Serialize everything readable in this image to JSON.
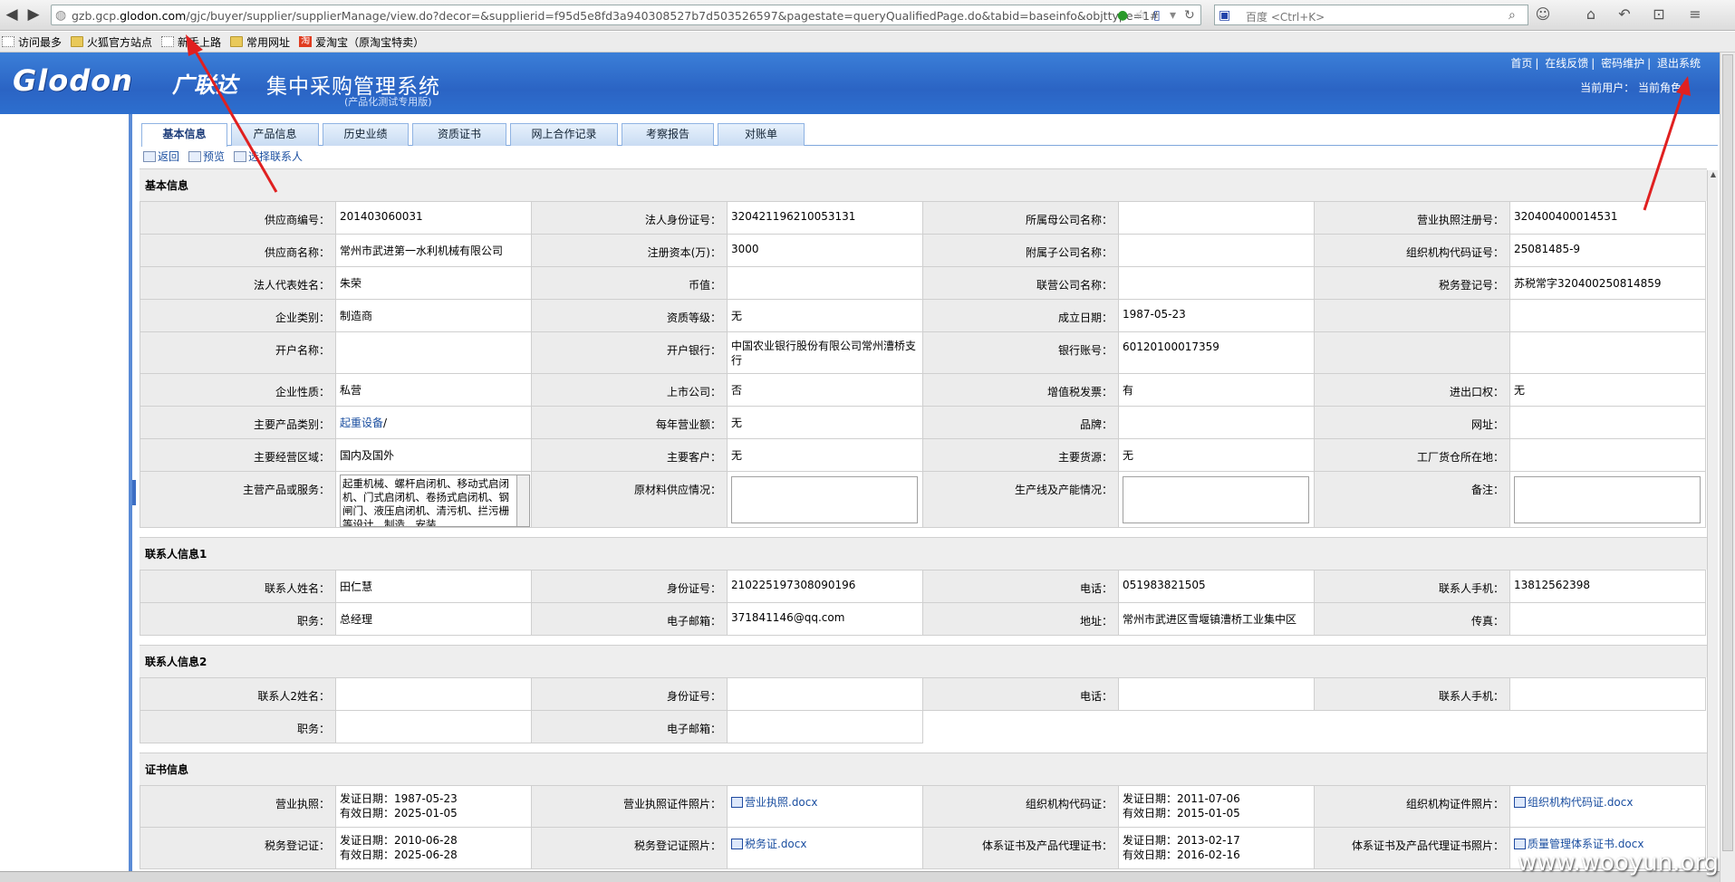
{
  "browser": {
    "url_prefix": "gzb.gcp.",
    "url_domain": "glodon.com",
    "url_path": "/gjc/buyer/supplier/supplierManage/view.do?decor=&supplierid=f95d5e8fd3a940308527b7d503526597&pagestate=queryQualifiedPage.do&tabid=baseinfo&objttype=1#",
    "search_placeholder": "百度 <Ctrl+K>"
  },
  "bookmarks": [
    "访问最多",
    "火狐官方站点",
    "新手上路",
    "常用网址",
    "爱淘宝（原淘宝特卖）"
  ],
  "header": {
    "logo": "Glodon",
    "logo_cn": "广联达",
    "title": "集中采购管理系统",
    "subtitle": "(产品化测试专用版)",
    "links": [
      "首页",
      "在线反馈",
      "密码维护",
      "退出系统"
    ],
    "user_info": "当前用户： 当前角色："
  },
  "tabs": [
    "基本信息",
    "产品信息",
    "历史业绩",
    "资质证书",
    "网上合作记录",
    "考察报告",
    "对账单"
  ],
  "actions": [
    "返回",
    "预览",
    "选择联系人"
  ],
  "sections": {
    "basic": "基本信息",
    "contact1": "联系人信息1",
    "contact2": "联系人信息2",
    "cert": "证书信息"
  },
  "basic": {
    "r1": [
      "供应商编号：",
      "201403060031",
      "法人身份证号：",
      "320421196210053131",
      "所属母公司名称：",
      "",
      "营业执照注册号：",
      "320400400014531"
    ],
    "r2": [
      "供应商名称：",
      "常州市武进第一水利机械有限公司",
      "注册资本(万)：",
      "3000",
      "附属子公司名称：",
      "",
      "组织机构代码证号：",
      "25081485-9"
    ],
    "r3": [
      "法人代表姓名：",
      "朱荣",
      "币值：",
      "",
      "联营公司名称：",
      "",
      "税务登记号：",
      "苏税常字320400250814859"
    ],
    "r4": [
      "企业类别：",
      "制造商",
      "资质等级：",
      "无",
      "成立日期：",
      "1987-05-23",
      "",
      ""
    ],
    "r5": [
      "开户名称：",
      "",
      "开户银行：",
      "中国农业银行股份有限公司常州漕桥支行",
      "银行账号：",
      "60120100017359",
      "",
      ""
    ],
    "r6": [
      "企业性质：",
      "私营",
      "上市公司：",
      "否",
      "增值税发票：",
      "有",
      "进出口权：",
      "无"
    ],
    "r7": [
      "主要产品类别：",
      "起重设备",
      "每年营业额：",
      "无",
      "品牌：",
      "",
      "网址：",
      ""
    ],
    "r8": [
      "主要经营区域：",
      "国内及国外",
      "主要客户：",
      "无",
      "主要货源：",
      "无",
      "工厂货仓所在地：",
      ""
    ],
    "r9_labels": [
      "主营产品或服务：",
      "原材料供应情况：",
      "生产线及产能情况：",
      "备注："
    ],
    "r9_service": "起重机械、螺杆启闭机、移动式启闭机、门式启闭机、卷扬式启闭机、钢闸门、液压启闭机、清污机、拦污栅等设计、制造、安装"
  },
  "contact1": {
    "r1": [
      "联系人姓名：",
      "田仁慧",
      "身份证号：",
      "210225197308090196",
      "电话：",
      "051983821505",
      "联系人手机：",
      "13812562398"
    ],
    "r2": [
      "职务：",
      "总经理",
      "电子邮箱：",
      "371841146@qq.com",
      "地址：",
      "常州市武进区雪堰镇漕桥工业集中区",
      "传真：",
      ""
    ]
  },
  "contact2": {
    "r1": [
      "联系人2姓名：",
      "",
      "身份证号：",
      "",
      "电话：",
      "",
      "联系人手机：",
      ""
    ],
    "r2": [
      "职务：",
      "",
      "电子邮箱：",
      ""
    ]
  },
  "cert": {
    "r1": [
      "营业执照：",
      "发证日期：1987-05-23",
      "有效日期：2025-01-05",
      "营业执照证件照片：",
      "营业执照.docx",
      "组织机构代码证：",
      "发证日期：2011-07-06",
      "有效日期：2015-01-05",
      "组织机构证件照片：",
      "组织机构代码证.docx"
    ],
    "r2": [
      "税务登记证：",
      "发证日期：2010-06-28",
      "有效日期：2025-06-28",
      "税务登记证照片：",
      "税务证.docx",
      "体系证书及产品代理证书：",
      "发证日期：2013-02-17",
      "有效日期：2016-02-16",
      "体系证书及产品代理证书照片：",
      "质量管理体系证书.docx"
    ]
  },
  "watermark": "www.wooyun.org",
  "colors": {
    "header_blue": "#2b64c4",
    "annotation_red": "#e02020",
    "link_blue": "#1a4ea0"
  }
}
